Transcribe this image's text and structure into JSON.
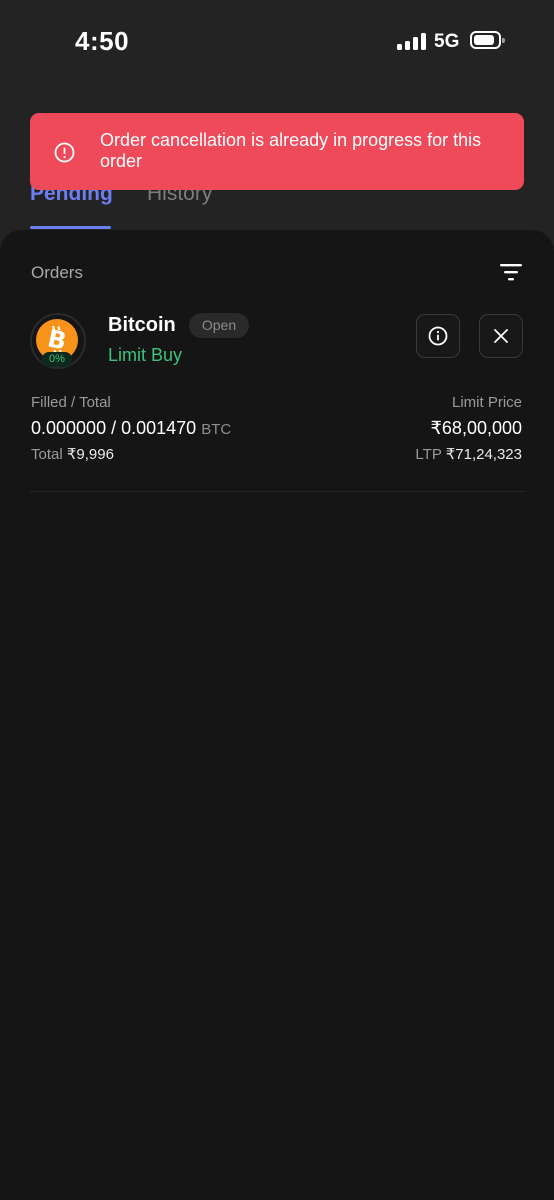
{
  "status_bar": {
    "time": "4:50",
    "network": "5G"
  },
  "tabs": [
    {
      "label": "Pending",
      "active": true
    },
    {
      "label": "History",
      "active": false
    }
  ],
  "toast": {
    "message": "Order cancellation is already in progress for this order",
    "color": "#ef4a5a"
  },
  "orders": {
    "title": "Orders",
    "items": [
      {
        "coin": "Bitcoin",
        "coin_icon": "bitcoin-icon",
        "fill_percent": "0%",
        "status": "Open",
        "order_type": "Limit Buy",
        "filled_label": "Filled / Total",
        "filled": "0.000000",
        "separator": " / ",
        "total_qty": "0.001470",
        "unit": "BTC",
        "total_label": "Total ",
        "total_value": "₹9,996",
        "limit_price_label": "Limit Price",
        "limit_price": "₹68,00,000",
        "ltp_label": "LTP ",
        "ltp": "₹71,24,323"
      }
    ]
  },
  "colors": {
    "accent": "#6c7ef0",
    "buy": "#3ec17c",
    "bitcoin": "#f7931a"
  }
}
